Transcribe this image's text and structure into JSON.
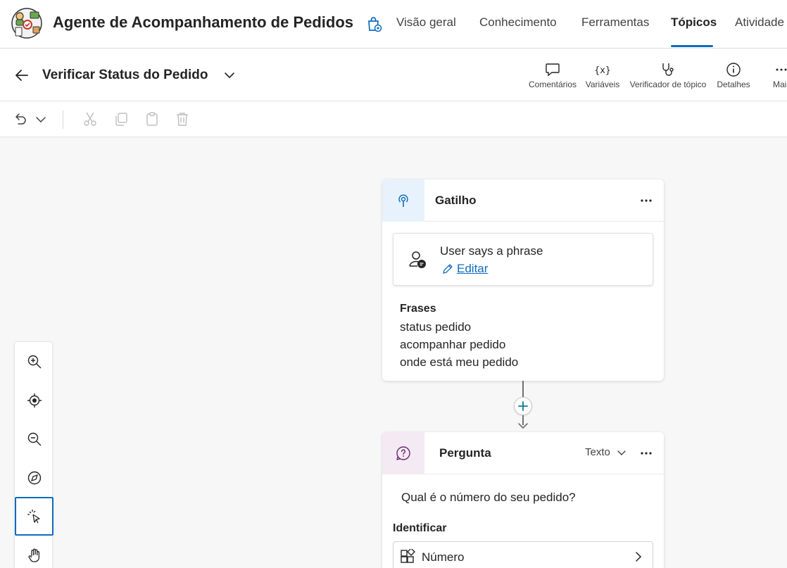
{
  "header": {
    "app_title": "Agente de Acompanhamento de Pedidos",
    "logo_icon": "delivery-agent-logo",
    "tabs": [
      {
        "label": "Visão geral",
        "active": false
      },
      {
        "label": "Conhecimento",
        "active": false
      },
      {
        "label": "Ferramentas",
        "active": false
      },
      {
        "label": "Tópicos",
        "active": true
      },
      {
        "label": "Atividade",
        "active": false
      }
    ],
    "accent_color": "#0f6cbd"
  },
  "subheader": {
    "topic_title": "Verificar Status do Pedido",
    "actions": [
      {
        "label": "Comentários",
        "icon": "comment-icon"
      },
      {
        "label": "Variáveis",
        "icon": "variables-icon"
      },
      {
        "label": "Verificador de tópico",
        "icon": "stethoscope-icon"
      },
      {
        "label": "Detalhes",
        "icon": "info-icon"
      },
      {
        "label": "Mais",
        "icon": "more-icon"
      }
    ]
  },
  "toolbar": {
    "icons": [
      "undo-icon",
      "chevron-down-icon",
      "cut-icon",
      "copy-icon",
      "paste-icon",
      "delete-icon"
    ]
  },
  "zoom_controls": {
    "icons": [
      "zoom-in-icon",
      "recenter-icon",
      "zoom-out-icon",
      "minimap-icon",
      "select-tool-icon",
      "hand-tool-icon"
    ],
    "selected": "select-tool-icon"
  },
  "trigger_card": {
    "title": "Gatilho",
    "trigger_name": "User says a phrase",
    "edit_label": "Editar",
    "phrases_title": "Frases",
    "phrases": [
      "status pedido",
      "acompanhar pedido",
      "onde está meu pedido"
    ],
    "head_color": "#e8f2fc"
  },
  "question_card": {
    "title": "Pergunta",
    "type_label": "Texto",
    "question": "Qual é o número do seu pedido?",
    "identify_label": "Identificar",
    "identify_value": "Número",
    "head_color": "#f3eaf3"
  }
}
